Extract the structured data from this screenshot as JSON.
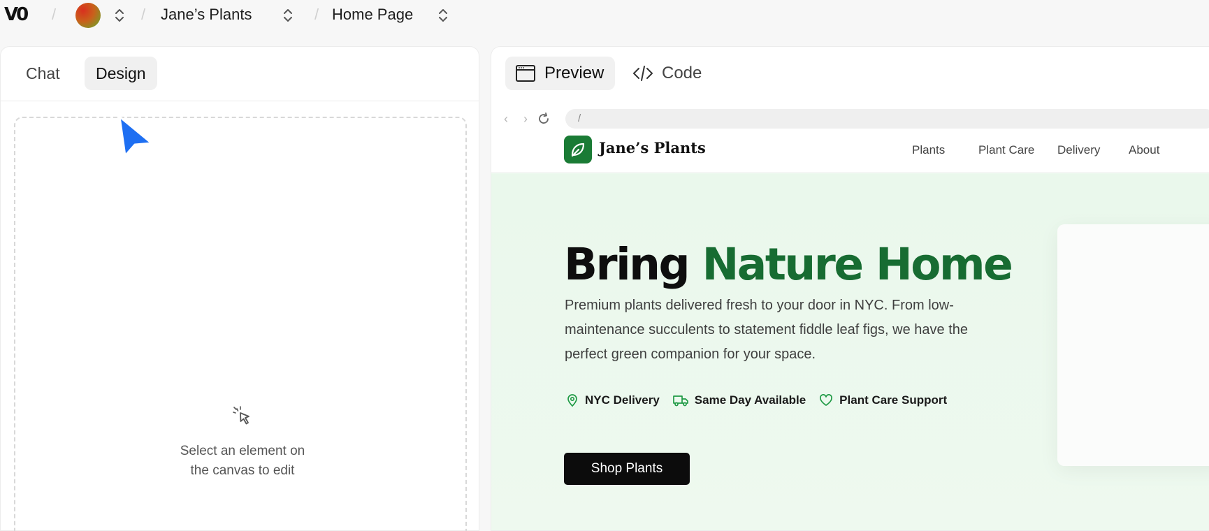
{
  "topbar": {
    "logo": "V0",
    "project": "Jane’s Plants",
    "page": "Home Page"
  },
  "left_panel": {
    "tabs": [
      {
        "label": "Chat",
        "active": false
      },
      {
        "label": "Design",
        "active": true
      }
    ],
    "hint": "Select an element on the canvas to edit"
  },
  "right_panel": {
    "tabs": [
      {
        "label": "Preview",
        "active": true,
        "icon": "window-icon"
      },
      {
        "label": "Code",
        "active": false,
        "icon": "code-icon"
      }
    ],
    "url": "/"
  },
  "site": {
    "brand": "Jane’s Plants",
    "nav_links": [
      "Plants",
      "Plant Care",
      "Delivery",
      "About"
    ],
    "hero": {
      "title_part1": "Bring ",
      "title_part2": "Nature Home",
      "description": "Premium plants delivered fresh to your door in NYC. From low-maintenance succulents to statement fiddle leaf figs, we have the perfect green companion for your space.",
      "features": [
        {
          "label": "NYC Delivery",
          "icon": "map-pin-icon"
        },
        {
          "label": "Same Day Available",
          "icon": "truck-icon"
        },
        {
          "label": "Plant Care Support",
          "icon": "heart-icon"
        }
      ],
      "cta": "Shop Plants"
    }
  },
  "colors": {
    "brand_green": "#176c32",
    "cursor_blue": "#1e6ff2",
    "hero_bg": "#eaf8ec"
  }
}
